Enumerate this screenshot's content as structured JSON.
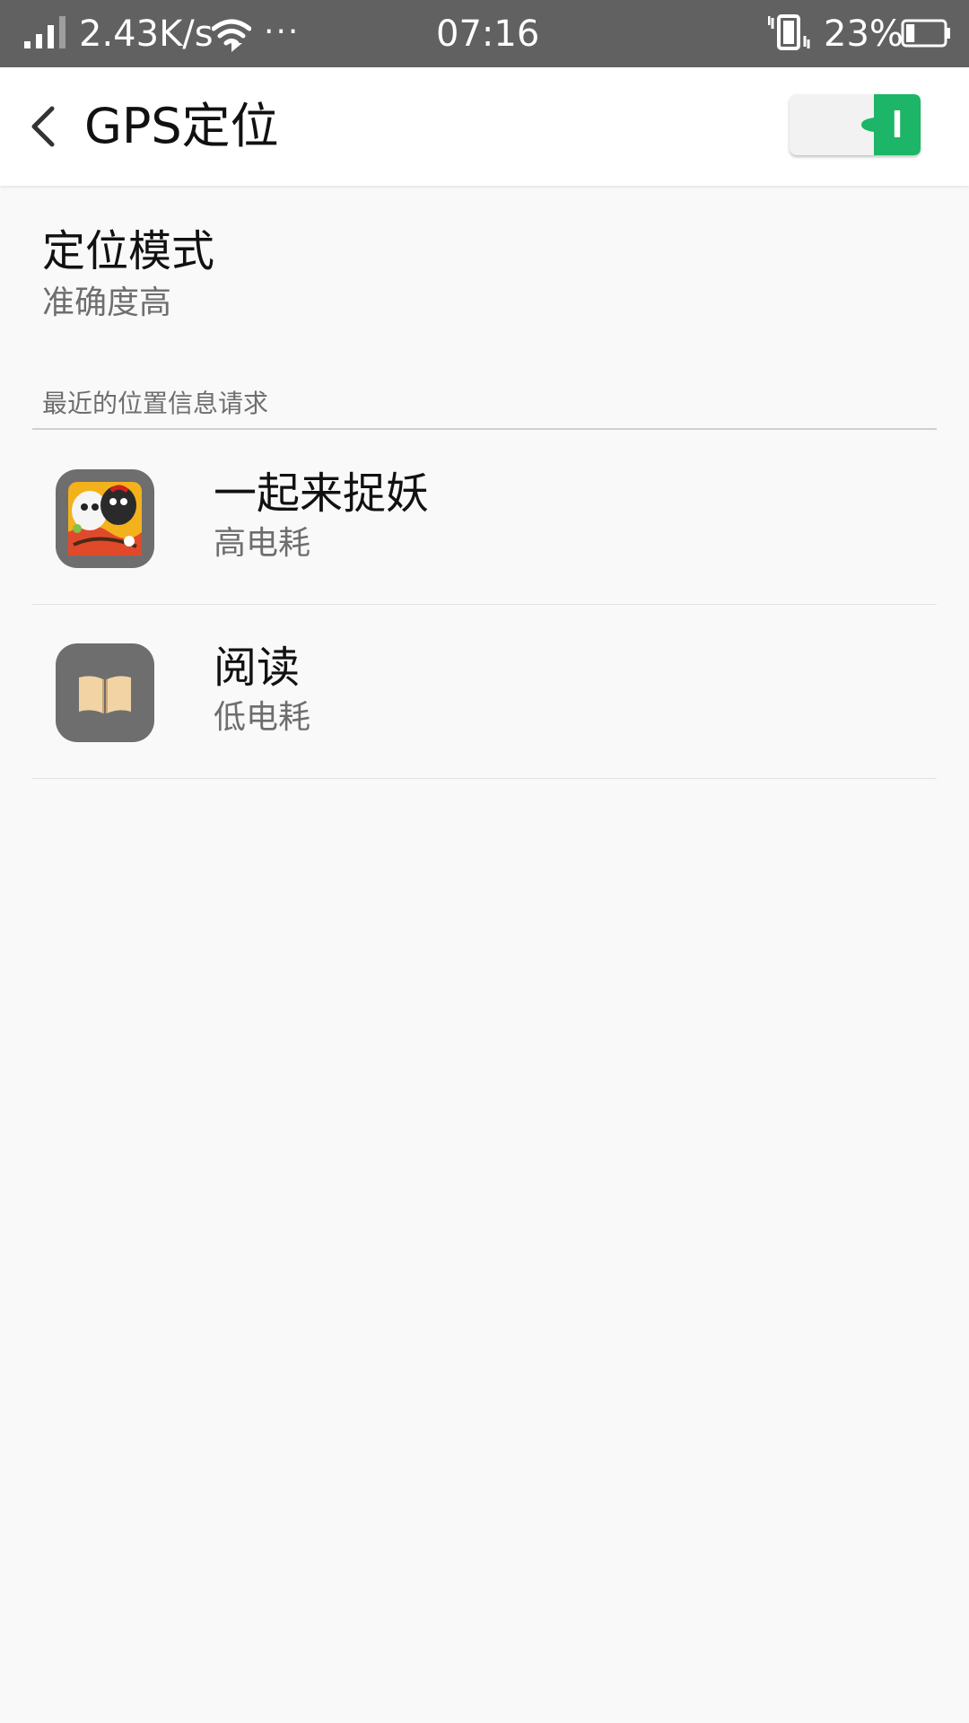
{
  "status_bar": {
    "network_speed": "2.43K/s",
    "more_indicator": "···",
    "time": "07:16",
    "battery_percent": "23%",
    "battery_level": 0.23
  },
  "header": {
    "title": "GPS定位",
    "toggle_state": "on",
    "toggle_on_label": "I",
    "accent_color": "#1db567"
  },
  "location_mode": {
    "title": "定位模式",
    "value": "准确度高"
  },
  "recent_requests": {
    "section_label": "最近的位置信息请求",
    "apps": [
      {
        "name": "一起来捉妖",
        "power": "高电耗",
        "icon": "game-icon"
      },
      {
        "name": "阅读",
        "power": "低电耗",
        "icon": "book-icon"
      }
    ]
  }
}
